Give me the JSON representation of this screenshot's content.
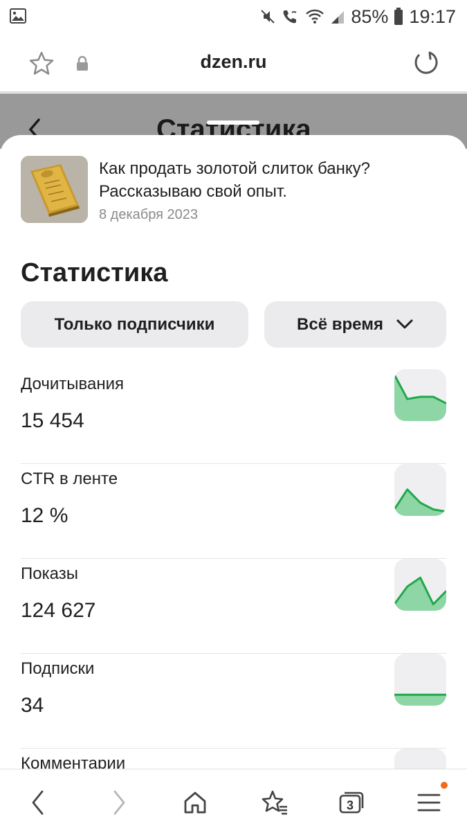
{
  "status_bar": {
    "battery": "85%",
    "time": "19:17",
    "icons": [
      "gallery-icon",
      "mute-icon",
      "wifi-call-icon",
      "wifi-icon",
      "signal-icon",
      "battery-icon"
    ]
  },
  "browser": {
    "url": "dzen.ru",
    "tabs_count": "3"
  },
  "background_page": {
    "title": "Статистика"
  },
  "article": {
    "title": "Как продать золотой слиток банку? Рассказываю свой опыт.",
    "date": "8 декабря 2023"
  },
  "stats": {
    "title": "Статистика",
    "filters": {
      "audience": "Только подписчики",
      "period": "Всё время"
    },
    "metrics": [
      {
        "label": "Дочитывания",
        "value": "15 454",
        "trend": [
          1.0,
          0.45,
          0.5,
          0.5,
          0.35
        ]
      },
      {
        "label": "CTR в ленте",
        "value": "12 %",
        "trend": [
          0.1,
          0.55,
          0.25,
          0.1,
          0.05
        ]
      },
      {
        "label": "Показы",
        "value": "124 627",
        "trend": [
          0.1,
          0.5,
          0.7,
          0.1,
          0.4
        ]
      },
      {
        "label": "Подписки",
        "value": "34",
        "trend": [
          0.2,
          0.2,
          0.2,
          0.2,
          0.2
        ]
      },
      {
        "label": "Комментарии",
        "value": ""
      }
    ]
  },
  "colors": {
    "spark_line": "#1fa84a",
    "spark_fill": "#8fd6a6",
    "notification_dot": "#f26a1b"
  }
}
